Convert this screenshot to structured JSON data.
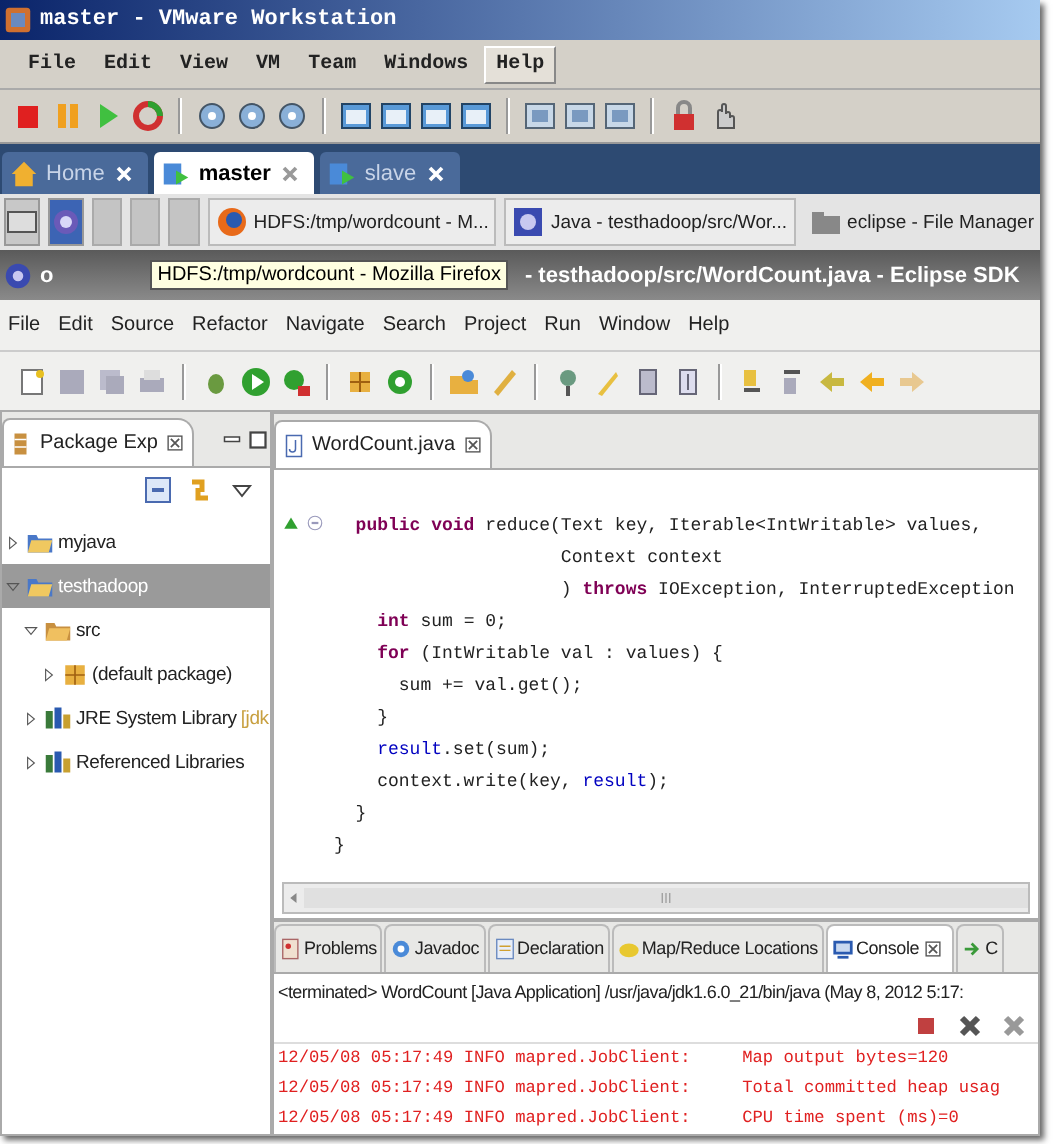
{
  "vmware": {
    "title": "master - VMware Workstation",
    "menu": [
      {
        "label": "File",
        "highlighted": false
      },
      {
        "label": "Edit",
        "highlighted": false
      },
      {
        "label": "View",
        "highlighted": false
      },
      {
        "label": "VM",
        "highlighted": false
      },
      {
        "label": "Team",
        "highlighted": false
      },
      {
        "label": "Windows",
        "highlighted": false
      },
      {
        "label": "Help",
        "highlighted": true
      }
    ],
    "tabs": [
      {
        "label": "Home",
        "kind": "home",
        "selected": false
      },
      {
        "label": "master",
        "kind": "vm",
        "selected": true
      },
      {
        "label": "slave",
        "kind": "vm",
        "selected": false
      }
    ]
  },
  "guest_taskbar": {
    "tasks": [
      {
        "label": "HDFS:/tmp/wordcount - M...",
        "kind": "browser"
      },
      {
        "label": "Java - testhadoop/src/Wor...",
        "kind": "eclipse"
      },
      {
        "label": "eclipse - File Manager",
        "kind": "folder"
      }
    ]
  },
  "eclipse": {
    "title_parts": [
      "o",
      "- testhadoop/src/WordCount.java - Eclipse SDK"
    ],
    "tooltip": "HDFS:/tmp/wordcount - Mozilla Firefox",
    "menu": [
      "File",
      "Edit",
      "Source",
      "Refactor",
      "Navigate",
      "Search",
      "Project",
      "Run",
      "Window",
      "Help"
    ]
  },
  "package_explorer": {
    "title": "Package Exp",
    "tree": [
      {
        "label": "myjava",
        "kind": "project",
        "expanded": false,
        "selected": false
      },
      {
        "label": "testhadoop",
        "kind": "project",
        "expanded": true,
        "selected": true,
        "children": [
          {
            "label": "src",
            "kind": "folder",
            "expanded": true,
            "selected": false,
            "children": [
              {
                "label": "(default package)",
                "kind": "package",
                "expanded": false,
                "selected": false
              }
            ]
          },
          {
            "label": "JRE System Library",
            "suffix": "[jdk",
            "kind": "library",
            "expanded": false,
            "selected": false
          },
          {
            "label": "Referenced Libraries",
            "kind": "library",
            "expanded": false,
            "selected": false
          }
        ]
      }
    ]
  },
  "editor": {
    "tab": "WordCount.java",
    "lines": [
      [
        {
          "text": "  public void",
          "kind": "keyword"
        },
        {
          "text": " reduce(Text key, Iterable<IntWritable> values,",
          "kind": "plain"
        }
      ],
      [
        {
          "text": "                     Context context",
          "kind": "plain"
        }
      ],
      [
        {
          "text": "                     ) ",
          "kind": "plain"
        },
        {
          "text": "throws",
          "kind": "keyword"
        },
        {
          "text": " IOException, InterruptedException",
          "kind": "plain"
        }
      ],
      [
        {
          "text": "    int",
          "kind": "keyword"
        },
        {
          "text": " sum = 0;",
          "kind": "plain"
        }
      ],
      [
        {
          "text": "    for",
          "kind": "keyword"
        },
        {
          "text": " (IntWritable val : values) {",
          "kind": "plain"
        }
      ],
      [
        {
          "text": "      sum += val.get();",
          "kind": "plain"
        }
      ],
      [
        {
          "text": "    }",
          "kind": "plain"
        }
      ],
      [
        {
          "text": "    result",
          "kind": "field"
        },
        {
          "text": ".set(sum);",
          "kind": "plain"
        }
      ],
      [
        {
          "text": "    context.write(key, ",
          "kind": "plain"
        },
        {
          "text": "result",
          "kind": "field"
        },
        {
          "text": ");",
          "kind": "plain"
        }
      ],
      [
        {
          "text": "  }",
          "kind": "plain"
        }
      ],
      [
        {
          "text": "}",
          "kind": "plain"
        }
      ]
    ]
  },
  "bottom_panel": {
    "tabs": [
      {
        "label": "Problems",
        "kind": "problems",
        "selected": false
      },
      {
        "label": "Javadoc",
        "kind": "javadoc",
        "selected": false
      },
      {
        "label": "Declaration",
        "kind": "declaration",
        "selected": false
      },
      {
        "label": "Map/Reduce Locations",
        "kind": "mapreduce",
        "selected": false
      },
      {
        "label": "Console",
        "kind": "console",
        "selected": true
      },
      {
        "label": "C",
        "kind": "call",
        "selected": false
      }
    ],
    "status": "<terminated> WordCount [Java Application] /usr/java/jdk1.6.0_21/bin/java (May 8, 2012 5:17:",
    "console_lines": [
      "12/05/08 05:17:49 INFO mapred.JobClient:     Map output bytes=120",
      "12/05/08 05:17:49 INFO mapred.JobClient:     Total committed heap usag",
      "12/05/08 05:17:49 INFO mapred.JobClient:     CPU time spent (ms)=0"
    ]
  }
}
